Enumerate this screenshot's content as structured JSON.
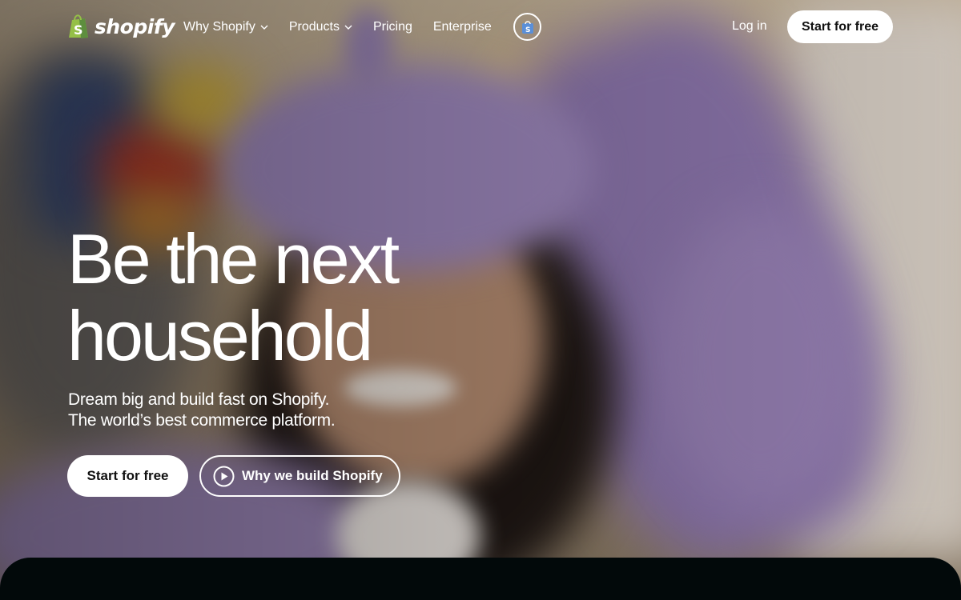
{
  "brand": {
    "name": "shopify",
    "logo_icon": "shopify-bag-icon",
    "logo_color": "#95bf47"
  },
  "nav": {
    "items": [
      {
        "label": "Why Shopify",
        "has_dropdown": true
      },
      {
        "label": "Products",
        "has_dropdown": true
      },
      {
        "label": "Pricing",
        "has_dropdown": false
      },
      {
        "label": "Enterprise",
        "has_dropdown": false
      }
    ],
    "badge_icon": "shop-app-icon",
    "login_label": "Log in",
    "start_label": "Start for free"
  },
  "hero": {
    "headline_line1": "Be the next",
    "headline_line2": "household",
    "subline1": "Dream big and build fast on Shopify.",
    "subline2": "The world’s best commerce platform.",
    "cta_primary_label": "Start for free",
    "cta_secondary_label": "Why we build Shopify",
    "cta_secondary_icon": "play-icon"
  },
  "colors": {
    "button_bg": "#ffffff",
    "button_text": "#111111",
    "bottom_panel": "#02090a"
  }
}
